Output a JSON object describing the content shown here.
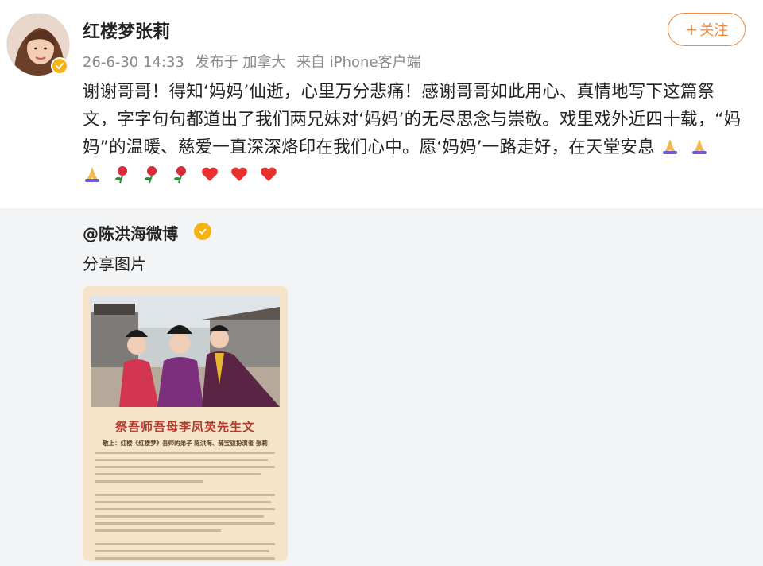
{
  "post": {
    "username": "红楼梦张莉",
    "meta": {
      "time": "26-6-30 14:33",
      "location": "发布于 加拿大",
      "source": "来自 iPhone客户端"
    },
    "follow_button": {
      "plus": "+",
      "label": "关注"
    },
    "text": "谢谢哥哥！得知‘妈妈’仙逝，心里万分悲痛！感谢哥哥如此用心、真情地写下这篇祭文，字字句句都道出了我们两兄妹对‘妈妈’的无尽思念与崇敬。戏里戏外近四十载，“妈妈”的温暖、慈爱一直深深烙印在我们心中。愿‘妈妈’一路走好，在天堂安息",
    "emojis": [
      "praying-hands",
      "praying-hands",
      "praying-hands",
      "rose",
      "rose",
      "rose",
      "red-heart",
      "red-heart",
      "red-heart"
    ]
  },
  "repost": {
    "author": "@陈洪海微博",
    "text": "分享图片",
    "image": {
      "title": "祭吾师吾母李凤英先生文",
      "subtitle": "敬上：红楼《红楼梦》吾师的弟子 陈洪海、薛宝钗扮演者 张莉"
    }
  },
  "colors": {
    "accent": "#f08a3c",
    "verified": "#f5b312",
    "repost_bg": "#f3f4f6",
    "article_title": "#b13b2f"
  }
}
